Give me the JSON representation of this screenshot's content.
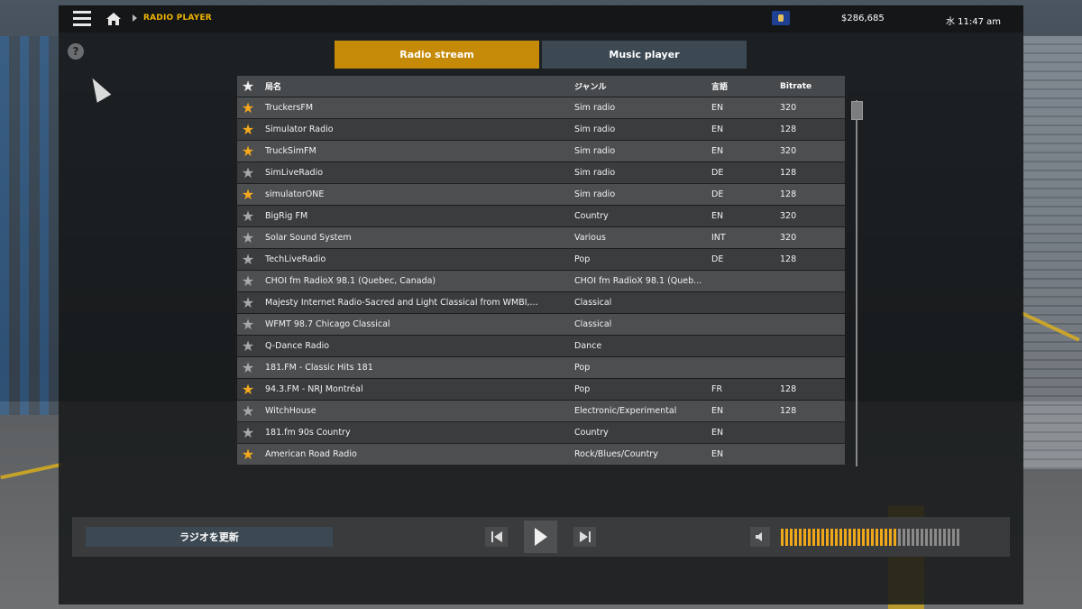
{
  "topbar": {
    "breadcrumb": "RADIO PLAYER",
    "money": "$286,685",
    "clock": "水 11:47 am",
    "menu_icon": "hamburger-icon",
    "home_icon": "home-icon"
  },
  "help": {
    "label": "?"
  },
  "tabs": [
    {
      "label": "Radio stream",
      "active": true
    },
    {
      "label": "Music player",
      "active": false
    }
  ],
  "table": {
    "headers": {
      "name": "局名",
      "genre": "ジャンル",
      "lang": "言語",
      "bitrate": "Bitrate"
    },
    "rows": [
      {
        "favorite": true,
        "name": "TruckersFM",
        "genre": "Sim radio",
        "lang": "EN",
        "bitrate": "320"
      },
      {
        "favorite": true,
        "name": "Simulator Radio",
        "genre": "Sim radio",
        "lang": "EN",
        "bitrate": "128"
      },
      {
        "favorite": true,
        "name": "TruckSimFM",
        "genre": "Sim radio",
        "lang": "EN",
        "bitrate": "320"
      },
      {
        "favorite": false,
        "name": "SimLiveRadio",
        "genre": "Sim radio",
        "lang": "DE",
        "bitrate": "128"
      },
      {
        "favorite": true,
        "name": "simulatorONE",
        "genre": "Sim radio",
        "lang": "DE",
        "bitrate": "128"
      },
      {
        "favorite": false,
        "name": "BigRig FM",
        "genre": "Country",
        "lang": "EN",
        "bitrate": "320"
      },
      {
        "favorite": false,
        "name": "Solar Sound System",
        "genre": "Various",
        "lang": "INT",
        "bitrate": "320"
      },
      {
        "favorite": false,
        "name": "TechLiveRadio",
        "genre": "Pop",
        "lang": "DE",
        "bitrate": "128"
      },
      {
        "favorite": false,
        "name": "CHOI fm RadioX 98.1 (Quebec, Canada)",
        "genre": "CHOI fm RadioX 98.1 (Queb...",
        "lang": "",
        "bitrate": ""
      },
      {
        "favorite": false,
        "name": "Majesty Internet Radio-Sacred and Light Classical from WMBI,...",
        "genre": "Classical",
        "lang": "",
        "bitrate": ""
      },
      {
        "favorite": false,
        "name": "WFMT 98.7 Chicago Classical",
        "genre": "Classical",
        "lang": "",
        "bitrate": ""
      },
      {
        "favorite": false,
        "name": "Q-Dance Radio",
        "genre": "Dance",
        "lang": "",
        "bitrate": ""
      },
      {
        "favorite": false,
        "name": "181.FM - Classic Hits 181",
        "genre": "Pop",
        "lang": "",
        "bitrate": ""
      },
      {
        "favorite": true,
        "name": "94.3.FM - NRJ Montréal",
        "genre": "Pop",
        "lang": "FR",
        "bitrate": "128"
      },
      {
        "favorite": false,
        "name": "WitchHouse",
        "genre": "Electronic/Experimental",
        "lang": "EN",
        "bitrate": "128"
      },
      {
        "favorite": false,
        "name": "181.fm 90s Country",
        "genre": "Country",
        "lang": "EN",
        "bitrate": ""
      },
      {
        "favorite": true,
        "name": "American Road Radio",
        "genre": "Rock/Blues/Country",
        "lang": "EN",
        "bitrate": ""
      }
    ]
  },
  "player": {
    "refresh_label": "ラジオを更新",
    "volume_level": 0.65,
    "volume_segments": 40
  },
  "colors": {
    "accent": "#c58a08",
    "favorite_star": "#f4a81d",
    "volume_on": "#f0a81b",
    "volume_off": "#8a8a8a"
  }
}
